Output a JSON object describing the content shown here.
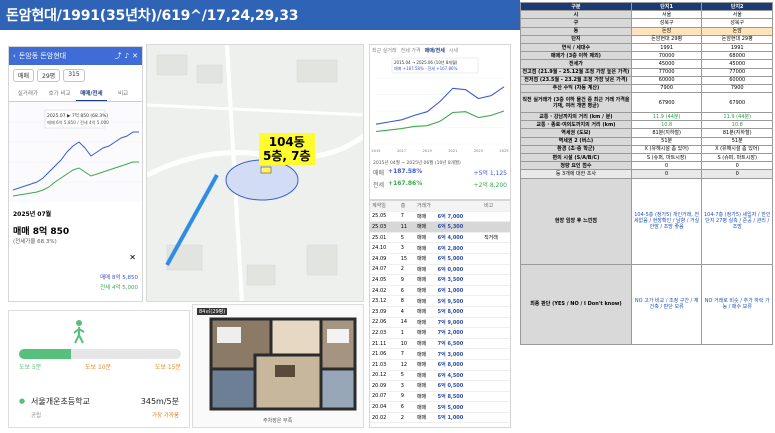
{
  "title": "돈암현대/1991(35년차)/619^/17,24,29,33",
  "phone": {
    "app_title": "돈암동 돈암현대",
    "filter_type": "매매",
    "filter_area": "29평",
    "filter_extra": "315",
    "tabs": [
      "실거래가",
      "호가 비교",
      "매매/전세",
      "비교"
    ],
    "chart_label": "2025.07 ▶ 7억 850 (68.3%)",
    "chart_sub": "매매 6억 5,850 / 전세 4억 5,000",
    "date_badge": "2025년 07월",
    "sale_big": "매매 8억 850",
    "ratio": "(전세가율 68.3%)",
    "side1": "매매 8억 5,850",
    "side2": "전세 4억 5,000"
  },
  "map": {
    "label_line1": "104동",
    "label_line2": "5층, 7층"
  },
  "chart": {
    "tabs": [
      "최근 실거래",
      "전세 가격",
      "매매/전세",
      "시세"
    ],
    "legend": "2015.04 → 2025.06 (10년 8개월)",
    "legend_sub": "매매 +187.58% · 전세 +167.86%",
    "footer_title": "2015년 04월 ~ 2025년 06월 (10년 8개월)",
    "stat1_label": "매매",
    "stat1_value": "+187.58%",
    "stat1_side": "+5억 1,125",
    "stat2_label": "전세",
    "stat2_value": "+167.86%",
    "stat2_side": "+2억 8,200",
    "chart_data": {
      "type": "line",
      "x": [
        "2015",
        "2016",
        "2017",
        "2018",
        "2019",
        "2020",
        "2021",
        "2022",
        "2023",
        "2024",
        "2025"
      ],
      "series": [
        {
          "name": "매매",
          "values": [
            2.7,
            3.0,
            3.3,
            3.9,
            4.4,
            5.8,
            7.6,
            7.4,
            6.2,
            6.6,
            7.8
          ]
        },
        {
          "name": "전세",
          "values": [
            1.7,
            1.9,
            2.1,
            2.4,
            2.5,
            3.1,
            4.3,
            4.4,
            3.6,
            3.9,
            4.5
          ]
        }
      ],
      "ylim": [
        0,
        9
      ]
    }
  },
  "tx": {
    "header": [
      "계약일",
      "층",
      "거래가",
      "비고"
    ],
    "rows": [
      {
        "date": "25.05",
        "floor": "7",
        "type": "매매",
        "price": "6억 7,000",
        "note": ""
      },
      {
        "date": "25.03",
        "floor": "11",
        "type": "매매",
        "price": "6억 5,300",
        "note": ""
      },
      {
        "date": "25.01",
        "floor": "5",
        "type": "매매",
        "price": "6억 4,000",
        "note": "직거래"
      },
      {
        "date": "24.10",
        "floor": "3",
        "type": "매매",
        "price": "6억 2,800",
        "note": ""
      },
      {
        "date": "24.09",
        "floor": "15",
        "type": "매매",
        "price": "6억 5,000",
        "note": ""
      },
      {
        "date": "24.07",
        "floor": "2",
        "type": "매매",
        "price": "6억 0,000",
        "note": ""
      },
      {
        "date": "24.05",
        "floor": "9",
        "type": "매매",
        "price": "6억 3,500",
        "note": ""
      },
      {
        "date": "24.02",
        "floor": "6",
        "type": "매매",
        "price": "6억 1,000",
        "note": ""
      },
      {
        "date": "23.12",
        "floor": "8",
        "type": "매매",
        "price": "5억 9,500",
        "note": ""
      },
      {
        "date": "23.09",
        "floor": "4",
        "type": "매매",
        "price": "5억 8,000",
        "note": ""
      },
      {
        "date": "22.06",
        "floor": "14",
        "type": "매매",
        "price": "7억 9,000",
        "note": ""
      },
      {
        "date": "22.03",
        "floor": "1",
        "type": "매매",
        "price": "7억 2,000",
        "note": ""
      },
      {
        "date": "21.11",
        "floor": "10",
        "type": "매매",
        "price": "7억 6,500",
        "note": ""
      },
      {
        "date": "21.06",
        "floor": "7",
        "type": "매매",
        "price": "7억 3,000",
        "note": ""
      },
      {
        "date": "21.03",
        "floor": "12",
        "type": "매매",
        "price": "6억 8,000",
        "note": ""
      },
      {
        "date": "20.12",
        "floor": "5",
        "type": "매매",
        "price": "6억 4,500",
        "note": ""
      },
      {
        "date": "20.09",
        "floor": "3",
        "type": "매매",
        "price": "6억 0,500",
        "note": ""
      },
      {
        "date": "20.07",
        "floor": "9",
        "type": "매매",
        "price": "5억 8,500",
        "note": ""
      },
      {
        "date": "20.04",
        "floor": "6",
        "type": "매매",
        "price": "5억 5,000",
        "note": ""
      },
      {
        "date": "20.02",
        "floor": "2",
        "type": "매매",
        "price": "5억 1,000",
        "note": ""
      }
    ]
  },
  "walk": {
    "tick1": "도보 5분",
    "tick2": "도보 10분",
    "tick3": "도보 15분",
    "school": "서울개운초등학교",
    "meta": "공립",
    "dist": "345m/5분",
    "meta2": "가장 가까움",
    "progress": 0.32
  },
  "plan": {
    "tag": "84㎡(29평)",
    "footer": "주차장은 부족"
  },
  "table": {
    "headers": [
      "구분",
      "단지1",
      "단지2"
    ],
    "rows": [
      {
        "label": "시",
        "v1": "서울",
        "v2": "서울",
        "cls": ""
      },
      {
        "label": "구",
        "v1": "성북구",
        "v2": "성북구",
        "cls": ""
      },
      {
        "label": "동",
        "v1": "돈암",
        "v2": "돈암",
        "cls": "hl"
      },
      {
        "label": "단지",
        "v1": "돈암현대 29평",
        "v2": "돈암현대 29평",
        "cls": ""
      },
      {
        "label": "연식 / 세대수",
        "v1": "1991",
        "v2": "1991",
        "cls": ""
      },
      {
        "label": "매매가 (3층 이하 제외)",
        "v1": "70000",
        "v2": "68000",
        "cls": ""
      },
      {
        "label": "전세가",
        "v1": "45000",
        "v2": "45000",
        "cls": ""
      },
      {
        "label": "전고점 (21.9월 - 25.12월 조정 가장 높은 가격)",
        "v1": "77000",
        "v2": "77000",
        "cls": ""
      },
      {
        "label": "전저점 (23.5월 - 23.2월 조정 가장 낮은 가격)",
        "v1": "60000",
        "v2": "60000",
        "cls": ""
      },
      {
        "label": "추산 수익 (차등 계산)",
        "v1": "7900",
        "v2": "7900",
        "cls": ""
      },
      {
        "label": "직전 실거래가 (3층 이하 물건 중 최근 거래 가격을 기재, 여러 개면 평균)",
        "v1": "67900",
        "v2": "67900",
        "cls": "tall"
      },
      {
        "label": "교통 · 강남까지의 거리 (km / 분)",
        "v1": "11.9 (44분)",
        "v2": "11.9 (44분)",
        "cls": "green"
      },
      {
        "label": "교통 · 종로·여의도까지의 거리 (km)",
        "v1": "10.8",
        "v2": "10.8",
        "cls": "green"
      },
      {
        "label": "역세권 (도보)",
        "v1": "81분(지하철)",
        "v2": "81분(지하철)",
        "cls": ""
      },
      {
        "label": "역세권 2 (버스)",
        "v1": "51분",
        "v2": "51분",
        "cls": ""
      },
      {
        "label": "환경 (초·중 학군)",
        "v1": "X (유해시설 좀 있어)",
        "v2": "X (유해시설 좀 있어)",
        "cls": ""
      },
      {
        "label": "편의 시설 (S/A/B/C)",
        "v1": "S (슈퍼, 마트시장)",
        "v2": "S (슈퍼, 마트시장)",
        "cls": ""
      },
      {
        "label": "정량 요인 점수",
        "v1": "0",
        "v2": "0",
        "cls": ""
      },
      {
        "label": "등 3개에 대한 조사",
        "v1": "0",
        "v2": "0",
        "cls": "gray"
      },
      {
        "label": "현장 임장 후 느낀점",
        "v1": "104-5층 (정가5) 개인거래, 전세없음 / 현장확인 / 남향 / 거실 안방 / 조망 좋음",
        "v2": "104-7층 (정가5) 세입자 / 한인단지 27평 실측 / 준공 / 관리 / 조망",
        "cls": "tall2"
      },
      {
        "label": "최종 판단 (YES / NO / I Don't know)",
        "v1": "NO 고가 비교 / 조정 구간 / 재건축 / 판단 보류",
        "v2": "NO 거래로 비슷 / 추가 하락 가능 / 매수 보류",
        "cls": "tall3"
      }
    ]
  },
  "colors": {
    "title_bg": "#2f63b5",
    "sale_line": "#3b5ad6",
    "rent_line": "#3ba84a",
    "label_bg": "#fffb2e",
    "table_header": "#1d3b73"
  }
}
